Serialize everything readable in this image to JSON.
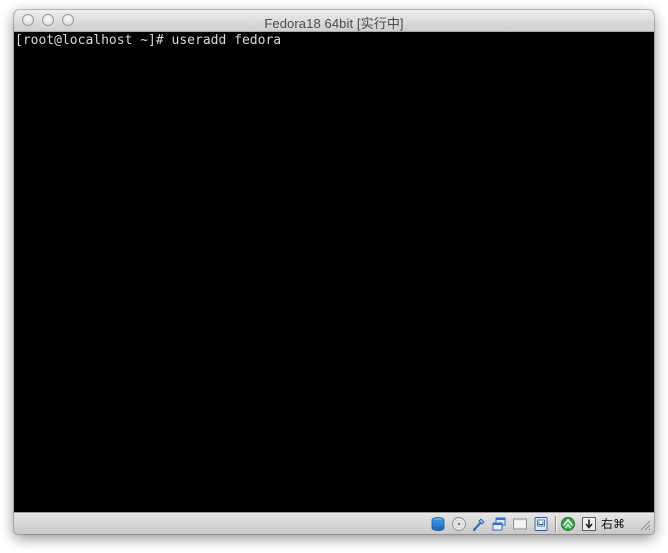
{
  "window": {
    "title": "Fedora18 64bit [实行中]"
  },
  "console": {
    "lines": [
      "[root@localhost ~]# useradd fedora"
    ]
  },
  "statusbar": {
    "icons": [
      "hard-disk-icon",
      "optical-drive-icon",
      "usb-icon",
      "shared-folders-icon",
      "display-icon",
      "video-capture-icon",
      "network-icon",
      "mouse-integration-icon"
    ],
    "host_key_label": "右⌘"
  },
  "colors": {
    "console_background": "#000000",
    "console_text": "#d8d8d8",
    "titlebar": "#d9d9d9",
    "hard_disk_accent": "#2f7fd6",
    "network_accent": "#3aa64a"
  }
}
